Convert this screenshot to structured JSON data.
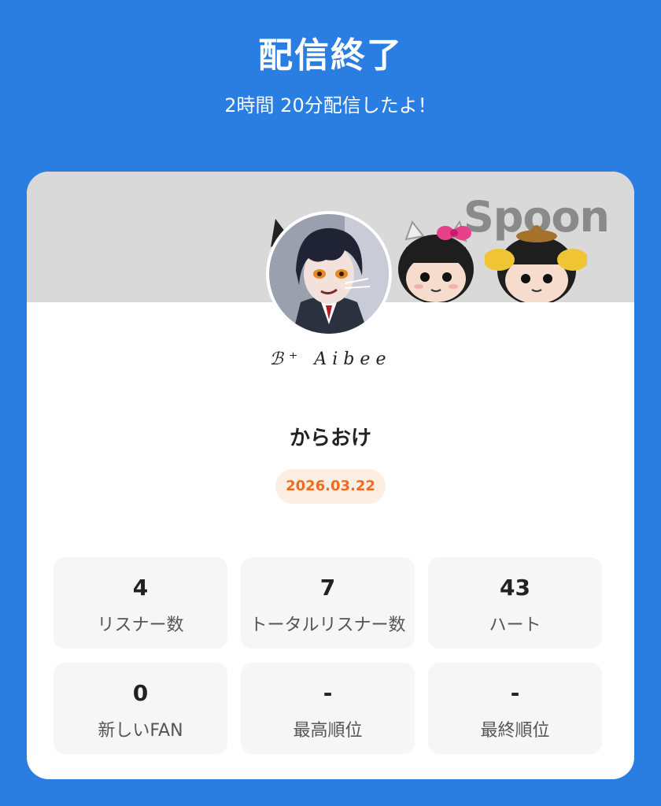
{
  "header": {
    "title": "配信終了",
    "subtitle": "2時間 20分配信したよ！"
  },
  "banner": {
    "logo": "Spoon",
    "background": "#d9d9d9"
  },
  "profile": {
    "signature": "ℬ⁺ Aibee"
  },
  "stream": {
    "title": "からおけ",
    "date": "2026.03.22"
  },
  "stats": [
    {
      "value": "4",
      "label": "リスナー数"
    },
    {
      "value": "7",
      "label": "トータルリスナー数"
    },
    {
      "value": "43",
      "label": "ハート"
    },
    {
      "value": "0",
      "label": "新しいFAN"
    },
    {
      "value": "-",
      "label": "最高順位"
    },
    {
      "value": "-",
      "label": "最終順位"
    }
  ],
  "colors": {
    "background": "#2a7de1",
    "date_text": "#f26b1d",
    "date_badge": "#fdeee3"
  }
}
